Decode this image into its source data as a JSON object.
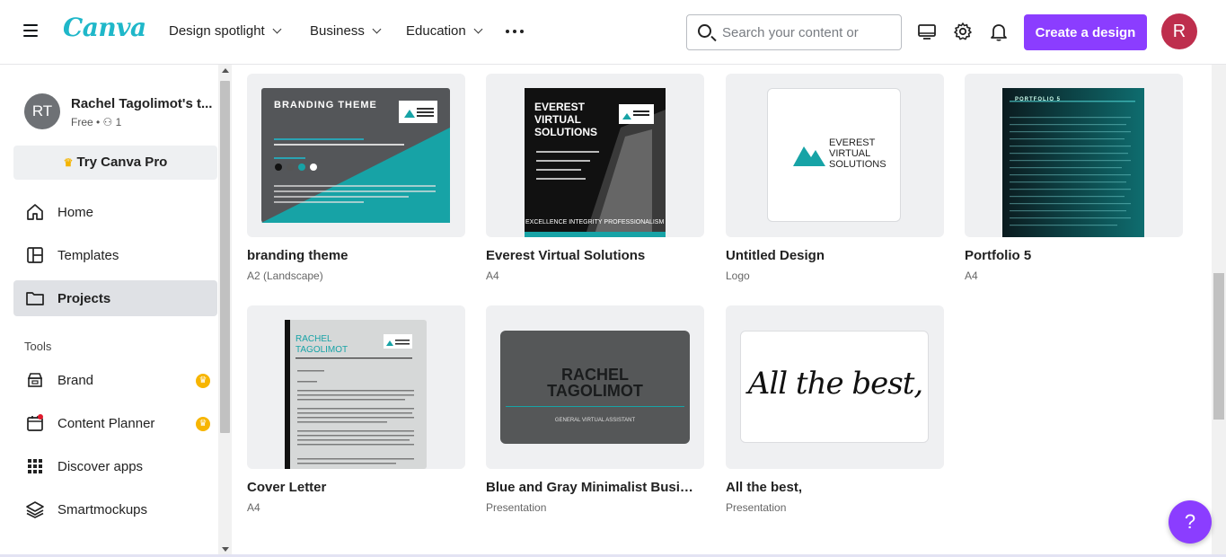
{
  "app": {
    "logo": "Canva"
  },
  "header": {
    "nav": [
      "Design spotlight",
      "Business",
      "Education"
    ],
    "search_placeholder": "Search your content or",
    "create_label": "Create a design",
    "user_initial": "R"
  },
  "sidebar": {
    "team_initials": "RT",
    "team_name": "Rachel Tagolimot's t...",
    "team_meta": "Free • ⚇ 1",
    "try_pro": "Try Canva Pro",
    "items": [
      {
        "label": "Home",
        "icon": "home-icon"
      },
      {
        "label": "Templates",
        "icon": "templates-icon"
      },
      {
        "label": "Projects",
        "icon": "folder-icon",
        "active": true
      }
    ],
    "tools_label": "Tools",
    "tools": [
      {
        "label": "Brand",
        "icon": "brand-icon",
        "pro": true
      },
      {
        "label": "Content Planner",
        "icon": "calendar-icon",
        "pro": true
      },
      {
        "label": "Discover apps",
        "icon": "apps-grid-icon"
      },
      {
        "label": "Smartmockups",
        "icon": "layers-icon"
      }
    ]
  },
  "designs": [
    {
      "title": "branding theme",
      "type": "A2 (Landscape)",
      "thumb": {
        "heading": "BRANDING THEME",
        "logo": "EVEREST VIRTUAL SOLUTIONS"
      }
    },
    {
      "title": "Everest Virtual Solutions",
      "type": "A4",
      "thumb": {
        "heading": "EVEREST VIRTUAL SOLUTIONS",
        "footer": "EXCELLENCE INTEGRITY PROFESSIONALISM ACCOUNTABILITY"
      }
    },
    {
      "title": "Untitled Design",
      "type": "Logo",
      "thumb": {
        "text": "EVEREST VIRTUAL SOLUTIONS"
      }
    },
    {
      "title": "Portfolio 5",
      "type": "A4",
      "thumb": {
        "heading": "PORTFOLIO 5"
      }
    },
    {
      "title": "Cover Letter",
      "type": "A4",
      "thumb": {
        "heading": "RACHEL TAGOLIMOT"
      }
    },
    {
      "title": "Blue and Gray Minimalist Busines...",
      "type": "Presentation",
      "thumb": {
        "heading": "RACHEL TAGOLIMOT",
        "sub": "GENERAL VIRTUAL ASSISTANT"
      }
    },
    {
      "title": "All the best,",
      "type": "Presentation",
      "thumb": {
        "script": "All the best,"
      }
    }
  ],
  "help_label": "?",
  "colors": {
    "accent": "#8b3dff",
    "teal": "#1fb7c9",
    "avatar": "#be2e4d"
  }
}
